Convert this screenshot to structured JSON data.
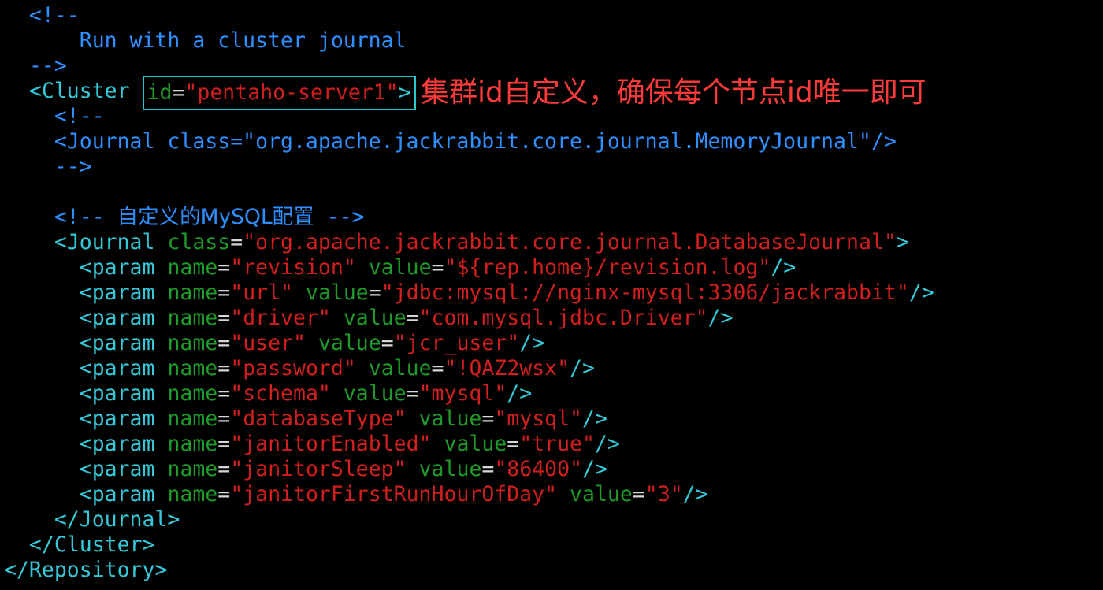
{
  "code": {
    "l1_open": "<!--",
    "l2_comment": "Run with a cluster journal",
    "l3_close": "-->",
    "l4_tag_open": "<Cluster",
    "l4_attr_id": "id",
    "l4_eq": "=",
    "l4_val_id": "\"pentaho-server1\"",
    "l4_tag_close": ">",
    "l5_open": "<!--",
    "l6_memory_journal": "<Journal class=\"org.apache.jackrabbit.core.journal.MemoryJournal\"/>",
    "l7_close": "-->",
    "l9_comment_open": "<!--",
    "l9_comment_text": "自定义的MySQL配置",
    "l9_comment_close": "-->",
    "l10_tag_open": "<Journal",
    "l10_attr": "class",
    "l10_val": "\"org.apache.jackrabbit.core.journal.DatabaseJournal\"",
    "l10_tag_close": ">",
    "param_tag": "<param",
    "name_attr": "name",
    "value_attr": "value",
    "eq": "=",
    "self_close": "/>",
    "params": [
      {
        "name": "\"revision\"",
        "value": "\"${rep.home}/revision.log\""
      },
      {
        "name": "\"url\"",
        "value": "\"jdbc:mysql://nginx-mysql:3306/jackrabbit\""
      },
      {
        "name": "\"driver\"",
        "value": "\"com.mysql.jdbc.Driver\""
      },
      {
        "name": "\"user\"",
        "value": "\"jcr_user\""
      },
      {
        "name": "\"password\"",
        "value": "\"!QAZ2wsx\""
      },
      {
        "name": "\"schema\"",
        "value": "\"mysql\""
      },
      {
        "name": "\"databaseType\"",
        "value": "\"mysql\""
      },
      {
        "name": "\"janitorEnabled\"",
        "value": "\"true\""
      },
      {
        "name": "\"janitorSleep\"",
        "value": "\"86400\""
      },
      {
        "name": "\"janitorFirstRunHourOfDay\"",
        "value": "\"3\""
      }
    ],
    "journal_close": "</Journal>",
    "cluster_close": "</Cluster>",
    "repository_close": "</Repository>"
  },
  "annotation": {
    "text": "集群id自定义，确保每个节点id唯一即可",
    "color": "#ff3a3a",
    "box_color": "#27c8cf"
  }
}
